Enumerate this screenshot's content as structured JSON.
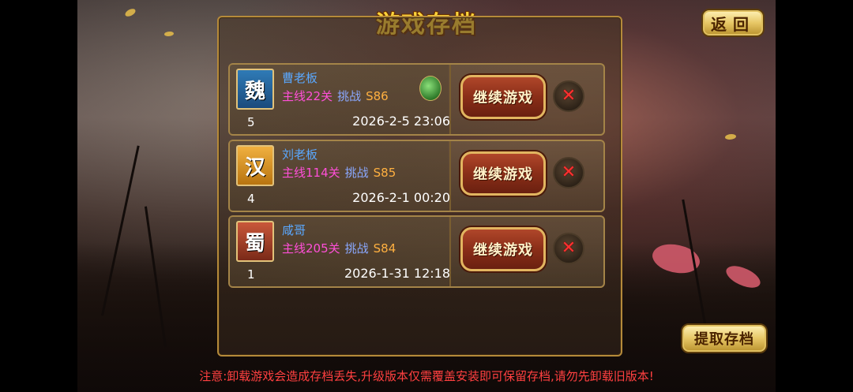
{
  "title": "游戏存档",
  "back_button": "返回",
  "extract_button": "提取存档",
  "warning": "注意:卸载游戏会造成存档丢失,升级版本仅需覆盖安装即可保留存档,请勿先卸载旧版本!",
  "saves": [
    {
      "faction": "魏",
      "faction_color": "#2f7bb6",
      "name": "曹老板",
      "main_progress": "主线22关",
      "challenge_label": "挑战",
      "server": "S86",
      "slot": "5",
      "time": "2026-2-5 23:06",
      "continue_label": "继续游戏",
      "has_medal": true,
      "medal_icon": "green-medal-icon"
    },
    {
      "faction": "汉",
      "faction_color": "#f0b040",
      "name": "刘老板",
      "main_progress": "主线114关",
      "challenge_label": "挑战",
      "server": "S85",
      "slot": "4",
      "time": "2026-2-1 00:20",
      "continue_label": "继续游戏"
    },
    {
      "faction": "蜀",
      "faction_color": "#c9573a",
      "name": "咸哥",
      "main_progress": "主线205关",
      "challenge_label": "挑战",
      "server": "S84",
      "slot": "1",
      "time": "2026-1-31 12:18",
      "continue_label": "继续游戏"
    }
  ],
  "colors": {
    "title": "#ffd43a",
    "player_name": "#5aa8ff",
    "main_progress": "#ff4fd8",
    "server": "#ffb040",
    "warning": "#ff4040"
  }
}
